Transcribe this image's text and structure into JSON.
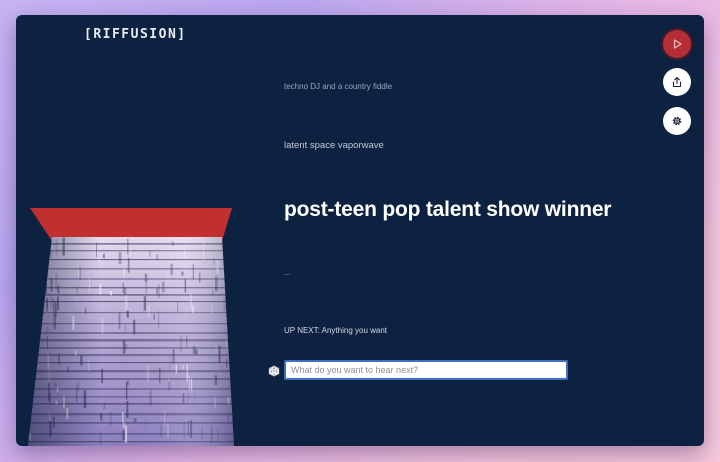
{
  "app": {
    "logo": "[RIFFUSION]"
  },
  "prompts": {
    "past_2": "techno DJ and a country fiddle",
    "past_1": "latent space vaporwave",
    "current": "post-teen pop talent show winner",
    "next_1": "..."
  },
  "up_next": {
    "label": "UP NEXT: Anything you want"
  },
  "input": {
    "placeholder": "What do you want to hear next?",
    "value": ""
  },
  "controls": {
    "play_icon": "play-icon",
    "share_icon": "share-icon",
    "settings_icon": "gear-icon",
    "dice_icon": "dice-icon"
  },
  "colors": {
    "background": "#0d2140",
    "accent_red": "#b52e35",
    "input_border": "#3d6fc9"
  }
}
